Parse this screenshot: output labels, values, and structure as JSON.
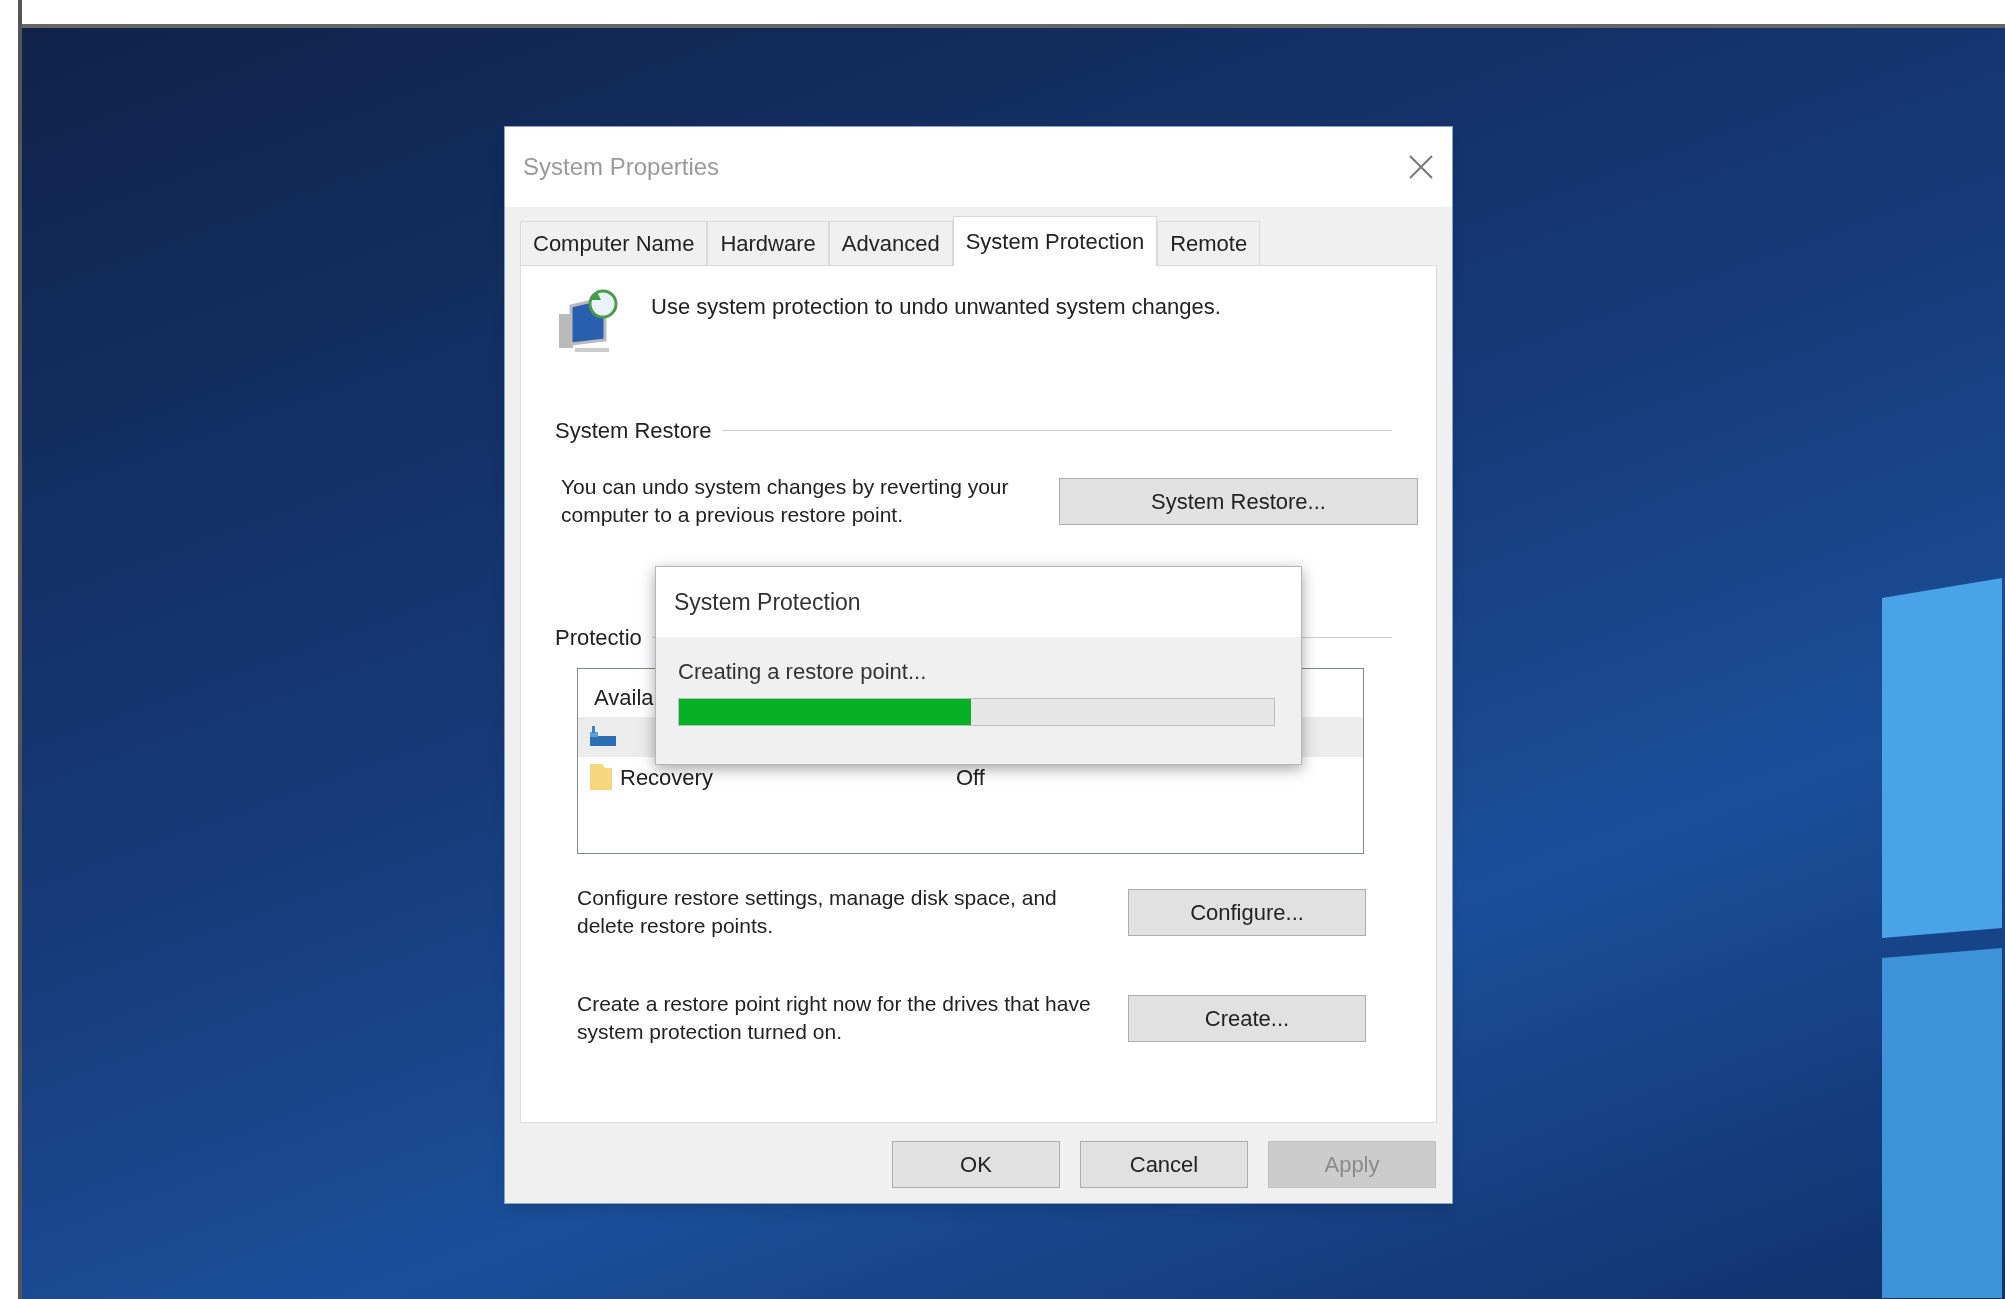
{
  "dialog": {
    "title": "System Properties",
    "tabs": [
      {
        "label": "Computer Name",
        "selected": false
      },
      {
        "label": "Hardware",
        "selected": false
      },
      {
        "label": "Advanced",
        "selected": false
      },
      {
        "label": "System Protection",
        "selected": true
      },
      {
        "label": "Remote",
        "selected": false
      }
    ],
    "intro": "Use system protection to undo unwanted system changes.",
    "system_restore": {
      "heading": "System Restore",
      "description": "You can undo system changes by reverting your computer to a previous restore point.",
      "button": "System Restore..."
    },
    "protection_settings": {
      "heading": "Protectio",
      "list_header": "Availa",
      "drives": [
        {
          "kind": "drive",
          "selected": true
        },
        {
          "kind": "folder",
          "name": "Recovery",
          "status": "Off",
          "selected": false
        }
      ]
    },
    "configure": {
      "description": "Configure restore settings, manage disk space, and delete restore points.",
      "button": "Configure..."
    },
    "create": {
      "description": "Create a restore point right now for the drives that have system protection turned on.",
      "button": "Create..."
    },
    "buttons": [
      {
        "label": "OK",
        "disabled": false
      },
      {
        "label": "Cancel",
        "disabled": false
      },
      {
        "label": "Apply",
        "disabled": true
      }
    ]
  },
  "progress_dialog": {
    "title": "System Protection",
    "message": "Creating a restore point...",
    "level": 0.49
  }
}
